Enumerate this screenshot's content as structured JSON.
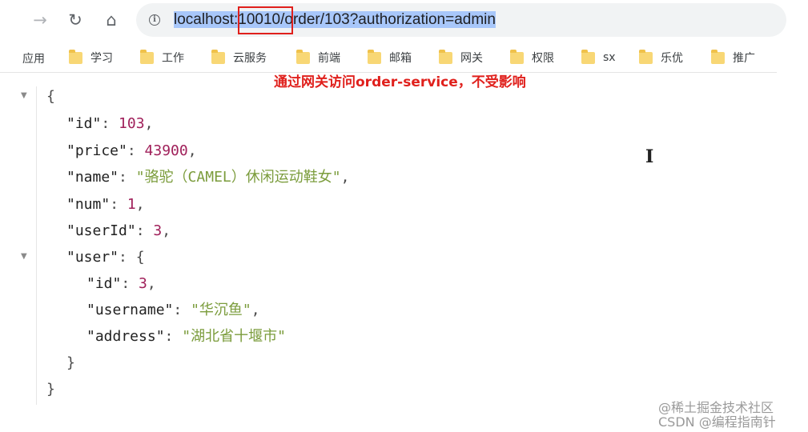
{
  "toolbar": {
    "back_icon": "→",
    "reload_icon": "↻",
    "home_icon": "⌂",
    "info_icon": "i",
    "url_host": "localhost",
    "url_sep": ":",
    "url_port": "10010",
    "url_path": "/order/103?authorization=admin"
  },
  "bookmarks": {
    "apps": "应用",
    "items": [
      {
        "label": "学习"
      },
      {
        "label": "工作"
      },
      {
        "label": "云服务"
      },
      {
        "label": "前端"
      },
      {
        "label": "邮箱"
      },
      {
        "label": "网关"
      },
      {
        "label": "权限"
      },
      {
        "label": "sx"
      },
      {
        "label": "乐优"
      },
      {
        "label": "推广"
      }
    ]
  },
  "annotation": "通过网关访问order-service，不受影响",
  "json_view": {
    "open_brace": "{",
    "fields": [
      {
        "key": "\"id\"",
        "value": "103",
        "kind": "num"
      },
      {
        "key": "\"price\"",
        "value": "43900",
        "kind": "num"
      },
      {
        "key": "\"name\"",
        "value": "\"骆驼（CAMEL）休闲运动鞋女\"",
        "kind": "str"
      },
      {
        "key": "\"num\"",
        "value": "1",
        "kind": "num"
      },
      {
        "key": "\"userId\"",
        "value": "3",
        "kind": "num"
      }
    ],
    "user_key": "\"user\"",
    "user_open": "{",
    "user_fields": [
      {
        "key": "\"id\"",
        "value": "3",
        "kind": "num"
      },
      {
        "key": "\"username\"",
        "value": "\"华沉鱼\"",
        "kind": "str"
      },
      {
        "key": "\"address\"",
        "value": "\"湖北省十堰市\"",
        "kind": "str"
      }
    ],
    "user_close": "}",
    "close_brace": "}",
    "toggle_icon": "▼"
  },
  "cursor_icon": "I",
  "watermark": {
    "line1": "@稀土掘金技术社区",
    "line2": "CSDN @编程指南针"
  },
  "colors": {
    "selection": "#a8c7fa",
    "highlight_box": "#e0201c",
    "number": "#a0205a",
    "string": "#7b9c3c"
  }
}
